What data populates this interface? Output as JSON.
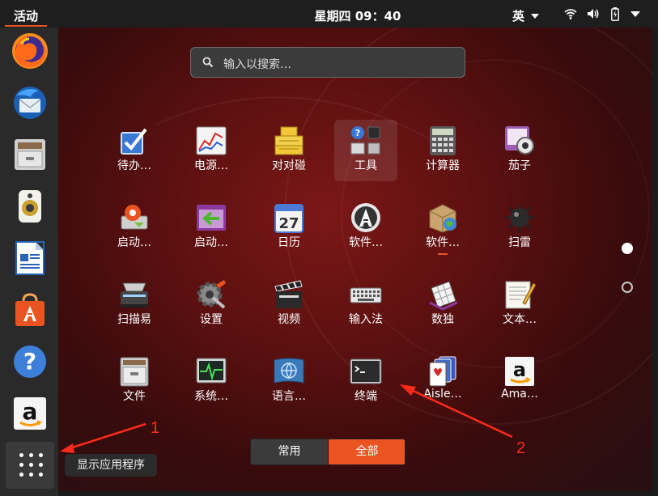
{
  "topbar": {
    "activities": "活动",
    "clock": "星期四 09：40",
    "input_method": "英"
  },
  "dock": {
    "items": [
      "firefox-icon",
      "thunderbird-icon",
      "files-icon",
      "rhythmbox-icon",
      "libreoffice-writer-icon",
      "software-center-icon",
      "help-icon",
      "amazon-icon"
    ],
    "show_apps_tooltip": "显示应用程序"
  },
  "search": {
    "placeholder": "输入以搜索…"
  },
  "apps": [
    {
      "label": "待办…",
      "icon": "todo-checkbox-icon"
    },
    {
      "label": "电源…",
      "icon": "power-statistics-icon"
    },
    {
      "label": "对对碰",
      "icon": "mahjongg-icon"
    },
    {
      "label": "工具",
      "icon": "utilities-folder-icon"
    },
    {
      "label": "计算器",
      "icon": "calculator-icon"
    },
    {
      "label": "茄子",
      "icon": "cheese-webcam-icon"
    },
    {
      "label": "启动…",
      "icon": "startup-disk-creator-icon"
    },
    {
      "label": "启动…",
      "icon": "startup-applications-icon"
    },
    {
      "label": "日历",
      "icon": "calendar-icon"
    },
    {
      "label": "软件…",
      "icon": "software-updater-icon"
    },
    {
      "label": "软件…",
      "icon": "software-properties-icon"
    },
    {
      "label": "扫雷",
      "icon": "mines-icon"
    },
    {
      "label": "扫描易",
      "icon": "scanner-icon"
    },
    {
      "label": "设置",
      "icon": "settings-gear-icon"
    },
    {
      "label": "视频",
      "icon": "videos-clapper-icon"
    },
    {
      "label": "输入法",
      "icon": "keyboard-icon"
    },
    {
      "label": "数独",
      "icon": "sudoku-icon"
    },
    {
      "label": "文本…",
      "icon": "text-editor-icon"
    },
    {
      "label": "文件",
      "icon": "file-cabinet-icon"
    },
    {
      "label": "系统…",
      "icon": "system-monitor-icon"
    },
    {
      "label": "语言…",
      "icon": "language-support-icon"
    },
    {
      "label": "终端",
      "icon": "terminal-icon"
    },
    {
      "label": "Aisle…",
      "icon": "aisleriot-cards-icon"
    },
    {
      "label": "Ama…",
      "icon": "amazon-icon"
    }
  ],
  "tabs": {
    "frequent": "常用",
    "all": "全部"
  },
  "annotations": {
    "first": "1",
    "second": "2"
  },
  "colors": {
    "accent": "#e95420",
    "annotation": "#ff2a1a"
  }
}
